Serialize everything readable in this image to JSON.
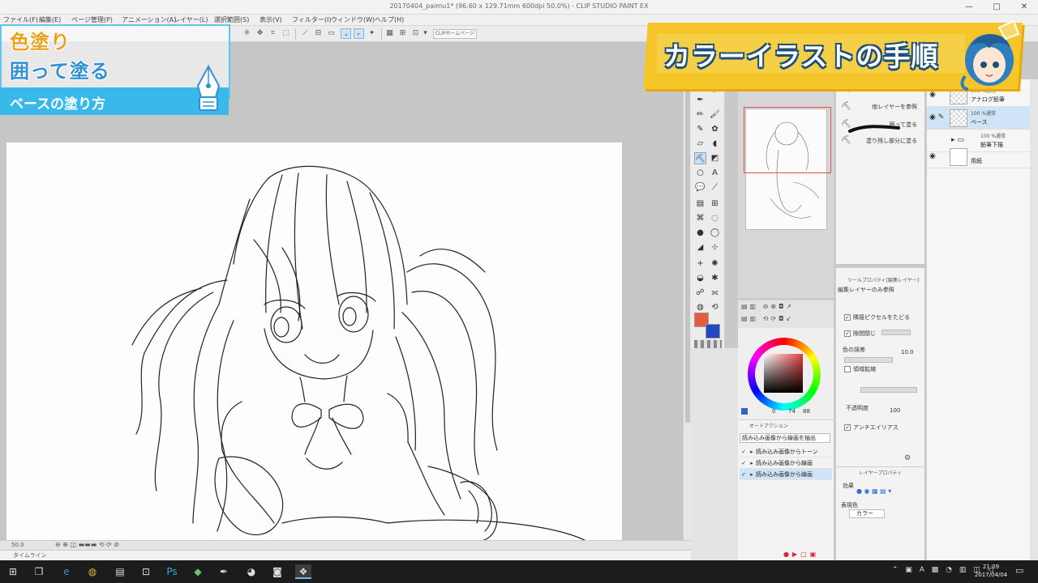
{
  "window": {
    "title": "20170404_paimu1* (96.60 x 129.71mm 600dpi 50.0%) - CLIP STUDIO PAINT EX",
    "buttons": [
      "—",
      "□",
      "✕"
    ]
  },
  "menu": {
    "items": [
      "ファイル(F)",
      "編集(E)",
      "ページ管理(P)",
      "アニメーション(A)",
      "レイヤー(L)",
      "選択範囲(S)",
      "表示(V)",
      "フィルター(I)",
      "ウィンドウ(W)",
      "ヘルプ(H)"
    ]
  },
  "toolbar": {
    "home_chip": "CLIPホームページ"
  },
  "overlay": {
    "line1": "色塗り",
    "line2": "囲って塗る",
    "bar": "ベースの塗り方",
    "banner": "カラーイラストの手順"
  },
  "sub_tool": {
    "items": [
      {
        "label": "編集レイヤーのみ参照",
        "icon": "fill-bucket"
      },
      {
        "label": "他レイヤーを参照",
        "icon": "fill-bucket"
      },
      {
        "label": "囲って塗る",
        "icon": "fill-bucket"
      },
      {
        "label": "塗り残し部分に塗る",
        "icon": "fill-bucket"
      }
    ]
  },
  "tool_property": {
    "tab": "ツールプロパティ[編集レイヤー]",
    "tool_name": "編集レイヤーのみ参照",
    "adjacent": "隣接ピクセルをたどる",
    "close_gap": "隙間閉じ",
    "color_margin": "色の誤差",
    "color_margin_value": "10.0",
    "area_scaling": "領域拡縮",
    "opacity": "不透明度",
    "opacity_value": "100",
    "antialias": "アンチエイリアス"
  },
  "layer_property": {
    "tab": "レイヤープロパティ",
    "effect_label": "効果",
    "expression_label": "表現色",
    "expression_value": "カラー"
  },
  "layers": [
    {
      "mode": "100 %通常",
      "name": "アナログ鉛筆",
      "selected": false,
      "visible": true
    },
    {
      "mode": "100 %通常",
      "name": "ベース",
      "selected": true,
      "visible": true
    },
    {
      "mode": "100 %通常",
      "name": "鉛筆下描",
      "selected": false,
      "visible": false
    },
    {
      "mode": "",
      "name": "用紙",
      "selected": false,
      "visible": true
    }
  ],
  "color_panel": {
    "values": [
      "0",
      "74",
      "88"
    ]
  },
  "auto_action": {
    "tab": "オートアクション",
    "selector": "読み込み画像から線画を抽出",
    "rows": [
      {
        "label": "読み込み画像からトーン",
        "highlighted": false
      },
      {
        "label": "読み込み画像から線画",
        "highlighted": false
      },
      {
        "label": "読み込み画像から線画",
        "highlighted": true
      }
    ]
  },
  "status": {
    "zoom": "50.0",
    "timeline_tab": "タイムライン"
  },
  "taskbar": {
    "time": "21:09",
    "date": "2017/04/04"
  },
  "colors": {
    "foreground": "#e75c40",
    "background": "#1f48c7",
    "overlay_blue": "#38b9ea",
    "banner_yellow": "#f6c52a"
  }
}
